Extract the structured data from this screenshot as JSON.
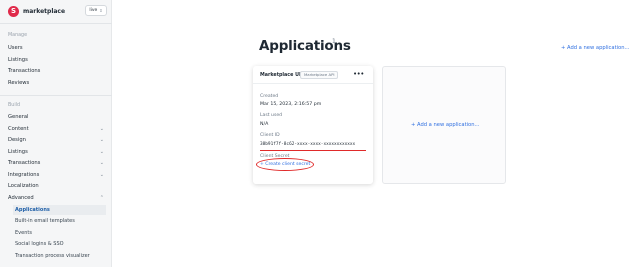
{
  "brand": {
    "name": "marketplace",
    "logo_letter": "S"
  },
  "env": {
    "label": "live"
  },
  "sidebar": {
    "manage_title": "Manage",
    "manage_items": [
      "Users",
      "Listings",
      "Transactions",
      "Reviews"
    ],
    "build_title": "Build",
    "build_items": [
      {
        "label": "General",
        "caret": ""
      },
      {
        "label": "Content",
        "caret": "⌄"
      },
      {
        "label": "Design",
        "caret": "⌄"
      },
      {
        "label": "Listings",
        "caret": "⌄"
      },
      {
        "label": "Transactions",
        "caret": "⌄"
      },
      {
        "label": "Integrations",
        "caret": "⌄"
      },
      {
        "label": "Localization",
        "caret": ""
      },
      {
        "label": "Advanced",
        "caret": "⌃"
      }
    ],
    "advanced_sub": [
      "Applications",
      "Built-in email templates",
      "Events",
      "Social logins & SSO",
      "Transaction process visualizer"
    ]
  },
  "main": {
    "title": "Applications",
    "count": "1",
    "add_link_top": "+ Add a new application...",
    "add_link_card": "+ Add a new application..."
  },
  "app_card": {
    "name": "Marketplace UI",
    "badge": "Marketplace API",
    "menu": "•••",
    "created_label": "Created",
    "created_value": "Mar 15, 2023, 2:16:57 pm",
    "last_used_label": "Last used",
    "last_used_value": "N/A",
    "client_id_label": "Client ID",
    "client_id_value": "38b91f7f-8c62-xxxx-xxxx-xxxxxxxxxxxx",
    "client_secret_label": "Client Secret",
    "create_secret_link": "+ Create client secret"
  },
  "colors": {
    "accent": "#2f6fe0",
    "brand": "#e02a4a",
    "annotation": "#e02a2a"
  }
}
